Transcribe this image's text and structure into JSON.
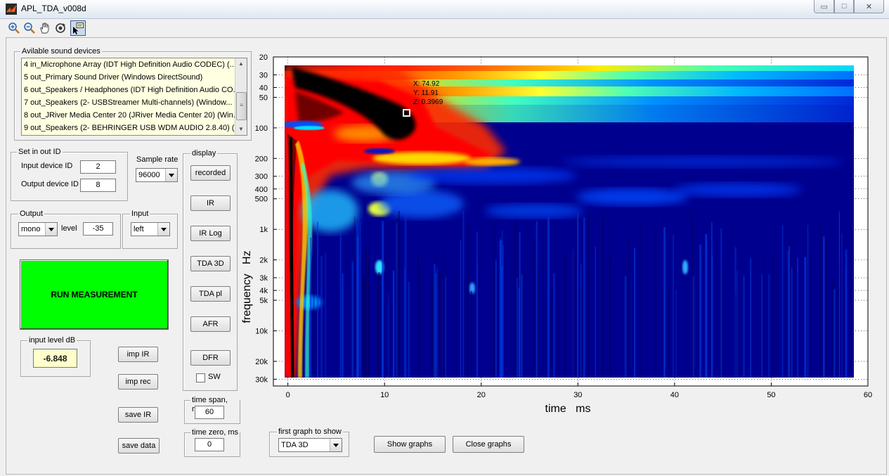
{
  "window": {
    "title": "APL_TDA_v008d",
    "controls": {
      "minimize": "▭",
      "maximize": "□",
      "close": "✕"
    }
  },
  "toolbar": {
    "tools": [
      {
        "name": "zoom-in",
        "icon": "zoom-in-icon"
      },
      {
        "name": "zoom-out",
        "icon": "zoom-out-icon"
      },
      {
        "name": "pan",
        "icon": "hand-icon"
      },
      {
        "name": "rotate-3d",
        "icon": "rotate-icon"
      },
      {
        "name": "data-cursor",
        "icon": "data-cursor-icon",
        "active": true
      }
    ]
  },
  "devices": {
    "title": "Avilable sound devices",
    "items": [
      "4 in_Microphone Array (IDT High Definition Audio CODEC) (...",
      "5 out_Primary Sound Driver (Windows DirectSound)",
      "6 out_Speakers / Headphones (IDT High Definition Audio CO...",
      "7 out_Speakers (2- USBStreamer Multi-channels) (Window...",
      "8 out_JRiver Media Center 20 (JRiver Media Center 20) (Win...",
      "9 out_Speakers (2- BEHRINGER USB WDM AUDIO 2.8.40) (..."
    ]
  },
  "set_io": {
    "title": "Set in out ID",
    "input_label": "Input device ID",
    "input_value": "2",
    "output_label": "Output device ID",
    "output_value": "8"
  },
  "sample_rate": {
    "label": "Sample rate",
    "value": "96000"
  },
  "output": {
    "title": "Output",
    "mode": "mono",
    "level_label": "level",
    "level_value": "-35"
  },
  "input": {
    "title": "Input",
    "channel": "left"
  },
  "run_button": "RUN MEASUREMENT",
  "input_level": {
    "title": "input level dB",
    "value": "-6.848"
  },
  "buttons": {
    "imp_ir": "imp IR",
    "imp_rec": "imp rec",
    "save_ir": "save IR",
    "save_data": "save data"
  },
  "display": {
    "title": "display",
    "buttons": [
      "recorded",
      "IR",
      "IR Log",
      "TDA 3D",
      "TDA pl",
      "AFR",
      "DFR"
    ],
    "sw_label": "SW"
  },
  "time_span": {
    "title": "time span, ms",
    "value": "60"
  },
  "time_zero": {
    "title": "time zero, ms",
    "value": "0"
  },
  "first_graph": {
    "title": "first graph to show",
    "value": "TDA 3D"
  },
  "show_graphs": "Show graphs",
  "close_graphs": "Close graphs",
  "chart_data": {
    "type": "heatmap",
    "title": "",
    "xlabel": "time   ms",
    "ylabel": "frequency   Hz",
    "x_ticks": [
      0,
      10,
      20,
      30,
      40,
      50,
      60
    ],
    "x_tick_labels": [
      "0",
      "10",
      "20",
      "30",
      "40",
      "50",
      "60"
    ],
    "xlim": [
      -1.5,
      60
    ],
    "y_scale": "log",
    "y_ticks": [
      20,
      30,
      40,
      50,
      100,
      200,
      300,
      400,
      500,
      1000,
      2000,
      3000,
      4000,
      5000,
      10000,
      20000,
      30000
    ],
    "y_tick_labels": [
      "20",
      "30",
      "40",
      "50",
      "100",
      "200",
      "300",
      "400",
      "500",
      "1k",
      "2k",
      "3k",
      "4k",
      "5k",
      "10k",
      "20k",
      "30k"
    ],
    "ylim": [
      20,
      35000
    ],
    "y_direction": "reversed",
    "colormap": "jet",
    "grid": "dotted",
    "datatip": {
      "x": 74.92,
      "y": 11.91,
      "z": 0.3969,
      "lines": [
        "X: 74.92",
        "Y: 11.91",
        "Z: 0.3969"
      ]
    }
  }
}
